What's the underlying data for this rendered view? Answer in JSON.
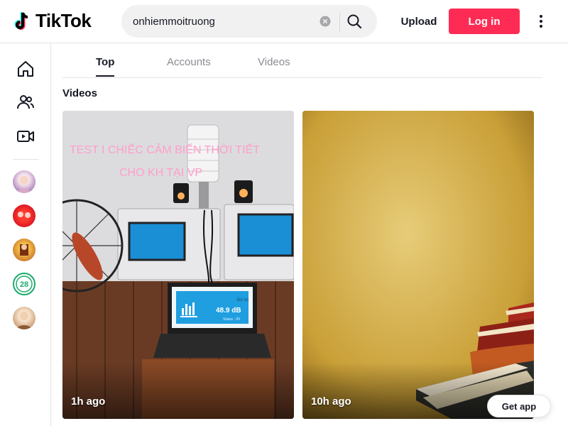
{
  "header": {
    "logo_text": "TikTok",
    "search_value": "onhiemmoitruong",
    "upload_label": "Upload",
    "login_label": "Log in",
    "login_color": "#fe2c55"
  },
  "sidebar": {
    "icons": [
      "home-icon",
      "following-icon",
      "live-icon"
    ],
    "avatars": [
      "avatar-1",
      "avatar-2",
      "avatar-3",
      "avatar-4",
      "avatar-5"
    ]
  },
  "tabs": [
    {
      "label": "Top",
      "active": true
    },
    {
      "label": "Accounts",
      "active": false
    },
    {
      "label": "Videos",
      "active": false
    }
  ],
  "section_title": "Videos",
  "videos": [
    {
      "time": "1h ago",
      "overlay_line1": "TEST I CHIẾC CẢM BIẾN THỜI TIẾT",
      "overlay_line2": "CHO KH TẠI VP",
      "screen_value": "48.9 dB",
      "screen_top": "Độ ồn",
      "screen_status": "Status : 00"
    },
    {
      "time": "10h ago"
    }
  ],
  "get_app_label": "Get app"
}
